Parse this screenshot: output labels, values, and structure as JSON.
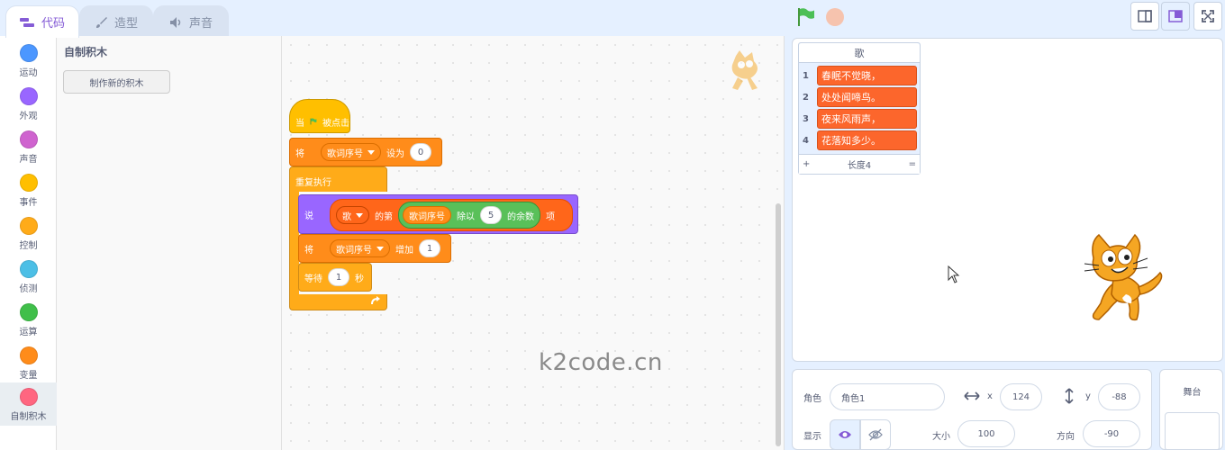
{
  "tabs": [
    {
      "label": "代码",
      "icon": "code-icon"
    },
    {
      "label": "造型",
      "icon": "brush-icon"
    },
    {
      "label": "声音",
      "icon": "speaker-icon"
    }
  ],
  "categories": [
    {
      "label": "运动",
      "color": "#4c97ff"
    },
    {
      "label": "外观",
      "color": "#9966ff"
    },
    {
      "label": "声音",
      "color": "#cf63cf"
    },
    {
      "label": "事件",
      "color": "#ffbf00"
    },
    {
      "label": "控制",
      "color": "#ffab19"
    },
    {
      "label": "侦测",
      "color": "#4cbfe6"
    },
    {
      "label": "运算",
      "color": "#40bf4a"
    },
    {
      "label": "变量",
      "color": "#ff8c1a"
    },
    {
      "label": "自制积木",
      "color": "#ff6680"
    }
  ],
  "palette": {
    "title": "自制积木",
    "make_block_label": "制作新的积木"
  },
  "script": {
    "when_flag": {
      "prefix": "当",
      "suffix": "被点击"
    },
    "set_var": {
      "verb": "将",
      "var": "歌词序号",
      "mid": "设为",
      "value": "0"
    },
    "forever": {
      "label": "重复执行"
    },
    "say": {
      "verb": "说",
      "list": "歌",
      "of_item": "的第",
      "mod_var": "歌词序号",
      "mod_op": "除以",
      "mod_value": "5",
      "mod_suffix": "的余数",
      "item_suffix": "项"
    },
    "change_var": {
      "verb": "将",
      "var": "歌词序号",
      "mid": "增加",
      "value": "1"
    },
    "wait": {
      "verb": "等待",
      "value": "1",
      "unit": "秒"
    }
  },
  "watermark": "k2code.cn",
  "list_monitor": {
    "title": "歌",
    "items": [
      {
        "index": "1",
        "value": "春眠不觉晓，"
      },
      {
        "index": "2",
        "value": "处处闻啼鸟。"
      },
      {
        "index": "3",
        "value": "夜来风雨声，"
      },
      {
        "index": "4",
        "value": "花落知多少。"
      }
    ],
    "add": "+",
    "length_label": "长度4",
    "resize": "="
  },
  "sprite_info": {
    "sprite_label": "角色",
    "sprite_name": "角色1",
    "x_label": "x",
    "x_value": "124",
    "y_label": "y",
    "y_value": "-88",
    "show_label": "显示",
    "size_label": "大小",
    "size_value": "100",
    "direction_label": "方向",
    "direction_value": "-90"
  },
  "stage_pane": {
    "title": "舞台"
  }
}
